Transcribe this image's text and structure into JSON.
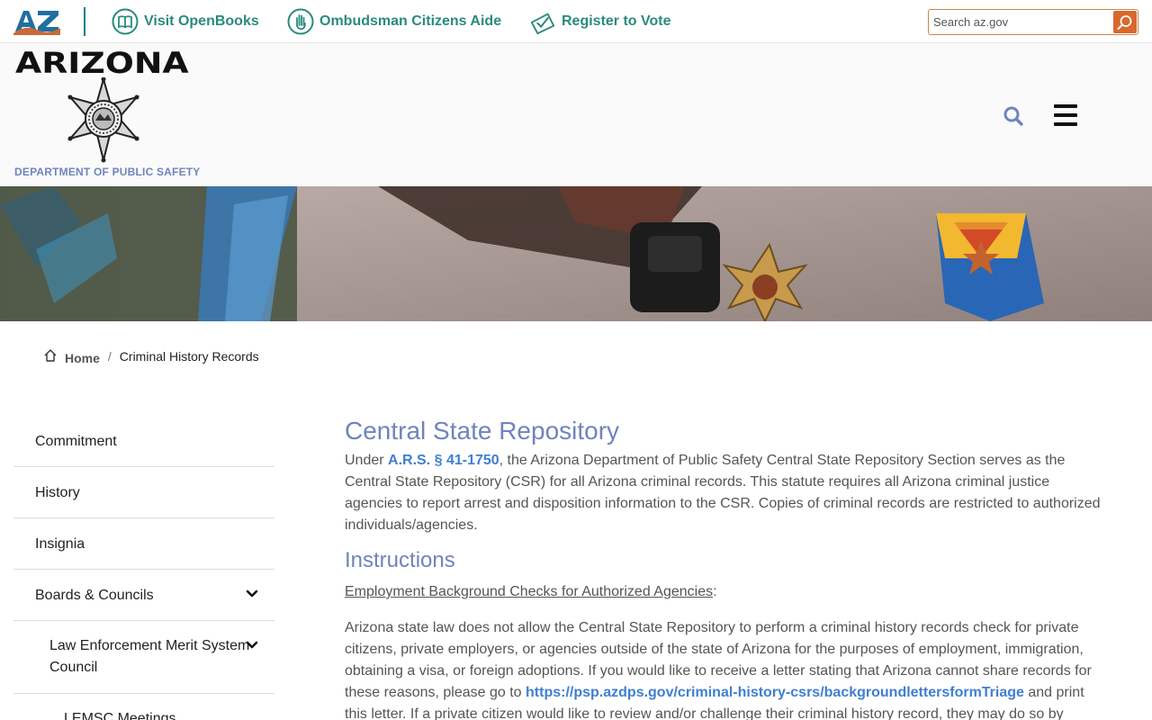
{
  "azbar": {
    "logo_text": "AZ",
    "links": [
      {
        "label": "Visit OpenBooks",
        "icon": "book-icon"
      },
      {
        "label": "Ombudsman Citizens Aide",
        "icon": "hand-icon"
      },
      {
        "label": "Register to Vote",
        "icon": "ballot-icon"
      }
    ],
    "search_placeholder": "Search az.gov"
  },
  "header": {
    "wordmark": "ARIZONA",
    "department": "DEPARTMENT OF PUBLIC SAFETY"
  },
  "breadcrumb": {
    "home": "Home",
    "separator": "/",
    "current": "Criminal History Records"
  },
  "sidenav": {
    "items": [
      {
        "label": "Commitment"
      },
      {
        "label": "History"
      },
      {
        "label": "Insignia"
      },
      {
        "label": "Boards & Councils"
      },
      {
        "label": "Law Enforcement Merit System Council"
      },
      {
        "label": "LEMSC Meetings"
      }
    ]
  },
  "main": {
    "title": "Central State Repository",
    "intro_pre": "Under ",
    "intro_link": "A.R.S. § 41-1750",
    "intro_post": ", the Arizona Department of Public Safety Central State Repository Section serves as the Central State Repository (CSR) for all Arizona criminal records. This statute requires all Arizona criminal justice agencies to report arrest and disposition information to the CSR. Copies of criminal records are restricted to authorized individuals/agencies.",
    "instructions_title": "Instructions",
    "employment_heading": "Employment Background Checks for Authorized Agencies",
    "employment_colon": ":",
    "para_pre": "Arizona state law does not allow the Central State Repository to perform a criminal history records check for private citizens, private employers, or agencies outside of the state of Arizona for the purposes of employment, immigration, obtaining a visa, or foreign adoptions. If you would like to receive a letter stating that Arizona cannot share records for these reasons, please go to ",
    "para_link": "https://psp.azdps.gov/criminal-history-csrs/backgroundlettersformTriage",
    "para_post": " and print this letter. If a private citizen would like to review and/or challenge their criminal history record, they may do so by"
  },
  "colors": {
    "accent_blue": "#6f84bd",
    "link_blue": "#3f7fd2",
    "az_teal": "#2a8a7e",
    "search_orange": "#d9682b"
  }
}
